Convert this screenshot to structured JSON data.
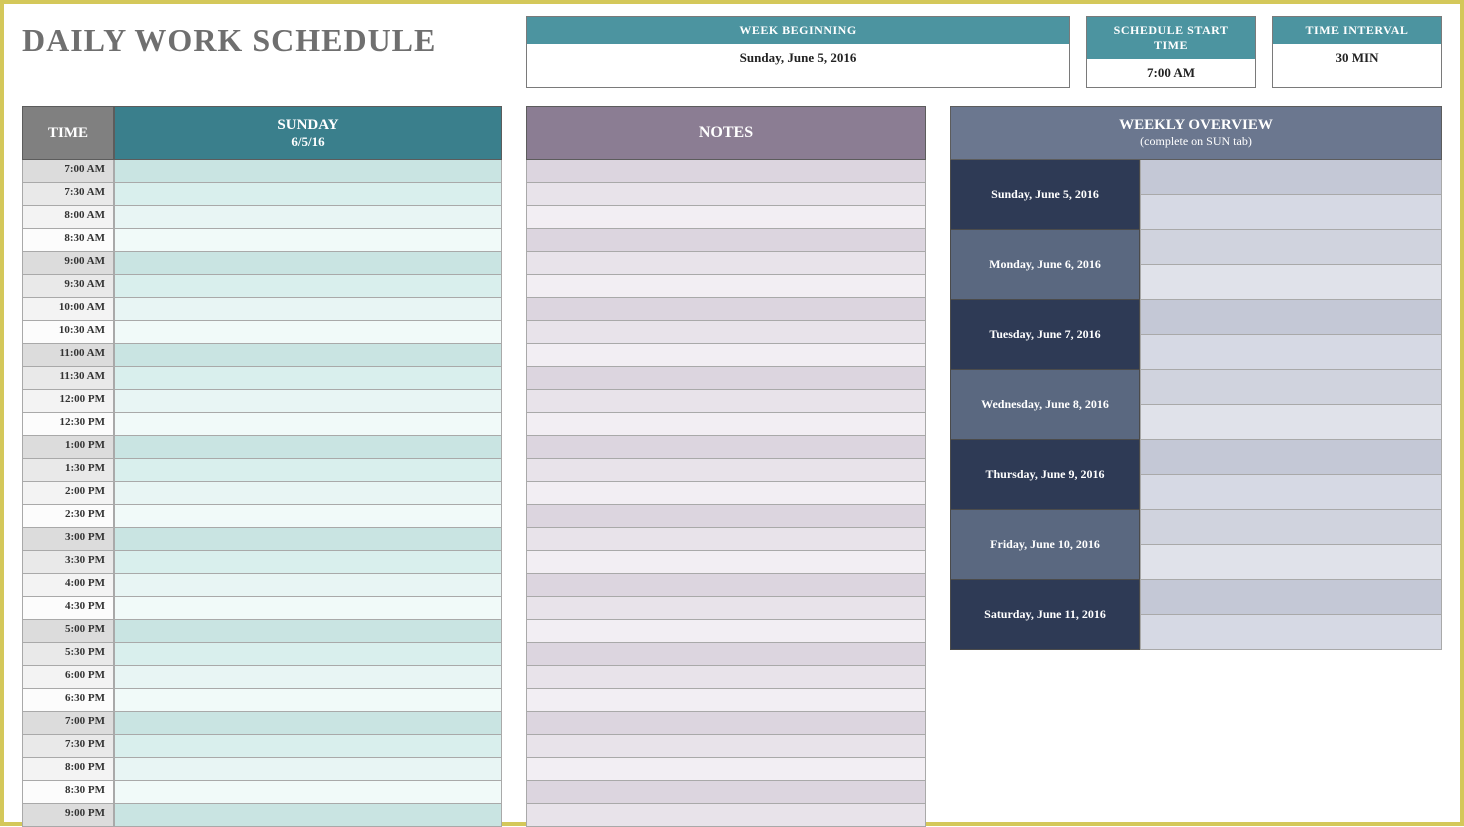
{
  "title": "DAILY WORK SCHEDULE",
  "info": {
    "week_beginning_label": "WEEK BEGINNING",
    "week_beginning_value": "Sunday, June 5, 2016",
    "start_time_label": "SCHEDULE START TIME",
    "start_time_value": "7:00 AM",
    "interval_label": "TIME INTERVAL",
    "interval_value": "30 MIN"
  },
  "schedule": {
    "time_header": "TIME",
    "day_header": "SUNDAY",
    "day_sub": "6/5/16",
    "times": [
      "7:00 AM",
      "7:30 AM",
      "8:00 AM",
      "8:30 AM",
      "9:00 AM",
      "9:30 AM",
      "10:00 AM",
      "10:30 AM",
      "11:00 AM",
      "11:30 AM",
      "12:00 PM",
      "12:30 PM",
      "1:00 PM",
      "1:30 PM",
      "2:00 PM",
      "2:30 PM",
      "3:00 PM",
      "3:30 PM",
      "4:00 PM",
      "4:30 PM",
      "5:00 PM",
      "5:30 PM",
      "6:00 PM",
      "6:30 PM",
      "7:00 PM",
      "7:30 PM",
      "8:00 PM",
      "8:30 PM",
      "9:00 PM"
    ]
  },
  "notes": {
    "header": "NOTES",
    "rows": 29
  },
  "weekly": {
    "header": "WEEKLY OVERVIEW",
    "sub": "(complete on SUN tab)",
    "days": [
      "Sunday, June 5, 2016",
      "Monday, June 6, 2016",
      "Tuesday, June 7, 2016",
      "Wednesday, June 8, 2016",
      "Thursday, June 9, 2016",
      "Friday, June 10, 2016",
      "Saturday, June 11, 2016"
    ]
  }
}
